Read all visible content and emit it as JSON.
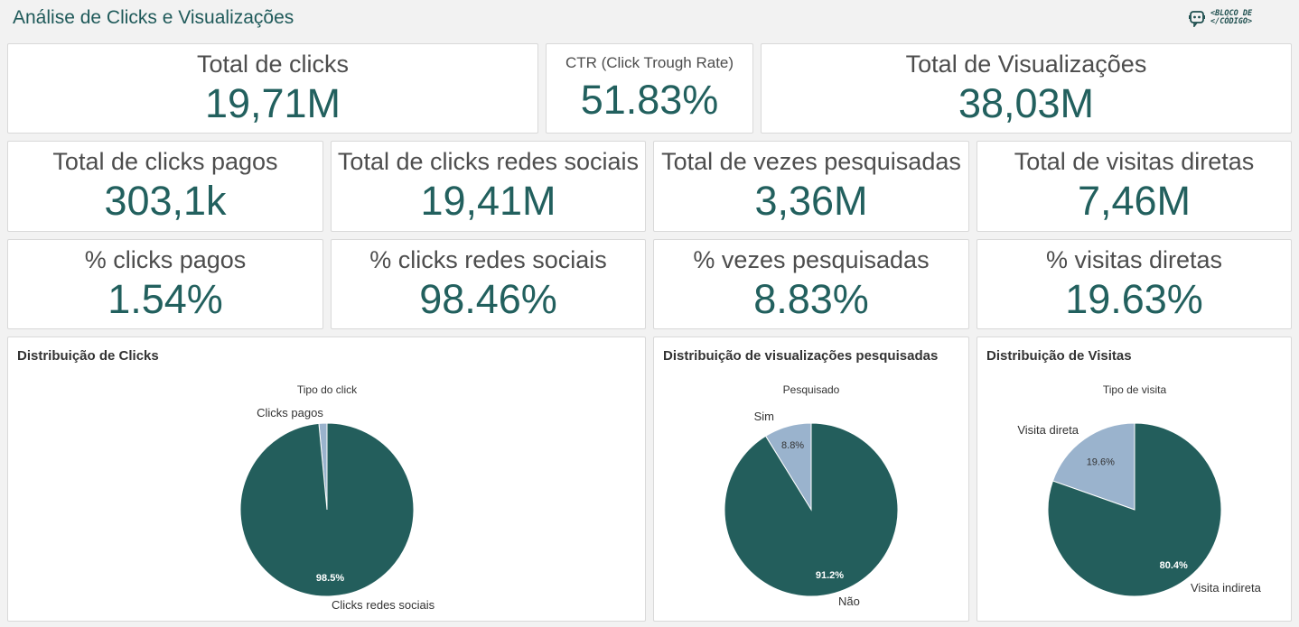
{
  "header": {
    "title": "Análise de Clicks e Visualizações",
    "logo_line1": "<BLOCO DE",
    "logo_line2": "</CÓDIGO>"
  },
  "colors": {
    "dark": "#235e5c",
    "light": "#9ab3cd",
    "value_text": "#22605e"
  },
  "kpis": {
    "total_clicks": {
      "label": "Total de clicks",
      "value": "19,71M"
    },
    "ctr": {
      "label": "CTR (Click Trough Rate)",
      "value": "51.83%"
    },
    "total_views": {
      "label": "Total de Visualizações",
      "value": "38,03M"
    },
    "paid_clicks": {
      "label": "Total de clicks pagos",
      "value": "303,1k"
    },
    "social_clicks": {
      "label": "Total de clicks redes sociais",
      "value": "19,41M"
    },
    "searched": {
      "label": "Total de vezes pesquisadas",
      "value": "3,36M"
    },
    "direct_visits": {
      "label": "Total de visitas diretas",
      "value": "7,46M"
    },
    "pct_paid": {
      "label": "% clicks pagos",
      "value": "1.54%"
    },
    "pct_social": {
      "label": "% clicks redes sociais",
      "value": "98.46%"
    },
    "pct_searched": {
      "label": "% vezes pesquisadas",
      "value": "8.83%"
    },
    "pct_direct": {
      "label": "% visitas diretas",
      "value": "19.63%"
    }
  },
  "chart_data": [
    {
      "type": "pie",
      "title": "Distribuição de Clicks",
      "legend_title": "Tipo do click",
      "slices": [
        {
          "name": "Clicks pagos",
          "value": 1.5,
          "label": ""
        },
        {
          "name": "Clicks redes sociais",
          "value": 98.5,
          "label": "98.5%"
        }
      ]
    },
    {
      "type": "pie",
      "title": "Distribuição de visualizações pesquisadas",
      "legend_title": "Pesquisado",
      "slices": [
        {
          "name": "Sim",
          "value": 8.8,
          "label": "8.8%"
        },
        {
          "name": "Não",
          "value": 91.2,
          "label": "91.2%"
        }
      ]
    },
    {
      "type": "pie",
      "title": "Distribuição de Visitas",
      "legend_title": "Tipo de visita",
      "slices": [
        {
          "name": "Visita direta",
          "value": 19.6,
          "label": "19.6%"
        },
        {
          "name": "Visita indireta",
          "value": 80.4,
          "label": "80.4%"
        }
      ]
    }
  ]
}
